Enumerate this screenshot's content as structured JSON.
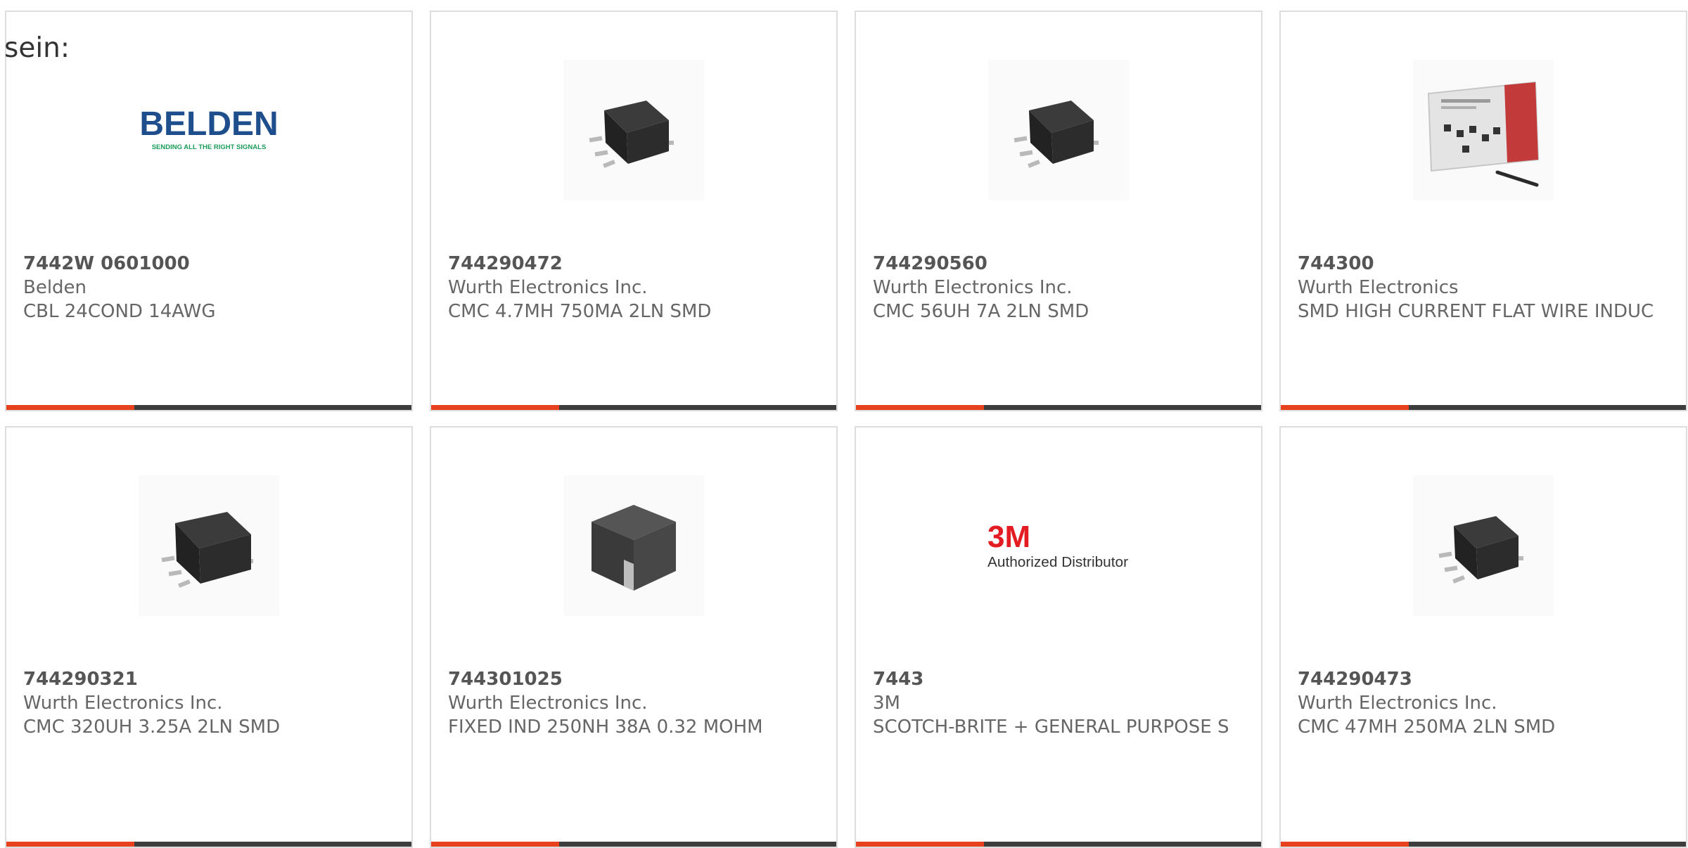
{
  "intro_text": "sein:",
  "colors": {
    "accent": "#e8411d",
    "rule": "#3d3d3d",
    "card_border": "#dddddd",
    "text": "#666666",
    "belden_blue": "#1f4e8c",
    "belden_green": "#1a9b5a",
    "brand_3m_red": "#e31b23"
  },
  "products": [
    {
      "part": "7442W 0601000",
      "manufacturer": "Belden",
      "description": "CBL 24COND 14AWG",
      "image": "belden-logo",
      "logo_text": "BELDEN",
      "logo_tagline": "SENDING ALL THE RIGHT SIGNALS"
    },
    {
      "part": "744290472",
      "manufacturer": "Wurth Electronics Inc.",
      "description": "CMC 4.7MH 750MA 2LN SMD",
      "image": "smd-common-mode-choke"
    },
    {
      "part": "744290560",
      "manufacturer": "Wurth Electronics Inc.",
      "description": "CMC 56UH 7A 2LN SMD",
      "image": "smd-common-mode-choke"
    },
    {
      "part": "744300",
      "manufacturer": "Wurth Electronics",
      "description": "SMD HIGH CURRENT FLAT WIRE INDUC",
      "image": "inductor-kit-box"
    },
    {
      "part": "744290321",
      "manufacturer": "Wurth Electronics Inc.",
      "description": "CMC 320UH 3.25A 2LN SMD",
      "image": "smd-common-mode-choke"
    },
    {
      "part": "744301025",
      "manufacturer": "Wurth Electronics Inc.",
      "description": "FIXED IND 250NH 38A 0.32 MOHM",
      "image": "power-inductor"
    },
    {
      "part": "7443",
      "manufacturer": "3M",
      "description": "SCOTCH-BRITE + GENERAL PURPOSE S",
      "image": "3m-logo",
      "logo_text": "3M",
      "logo_tagline": "Authorized Distributor"
    },
    {
      "part": "744290473",
      "manufacturer": "Wurth Electronics Inc.",
      "description": "CMC 47MH 250MA 2LN SMD",
      "image": "smd-common-mode-choke"
    }
  ]
}
